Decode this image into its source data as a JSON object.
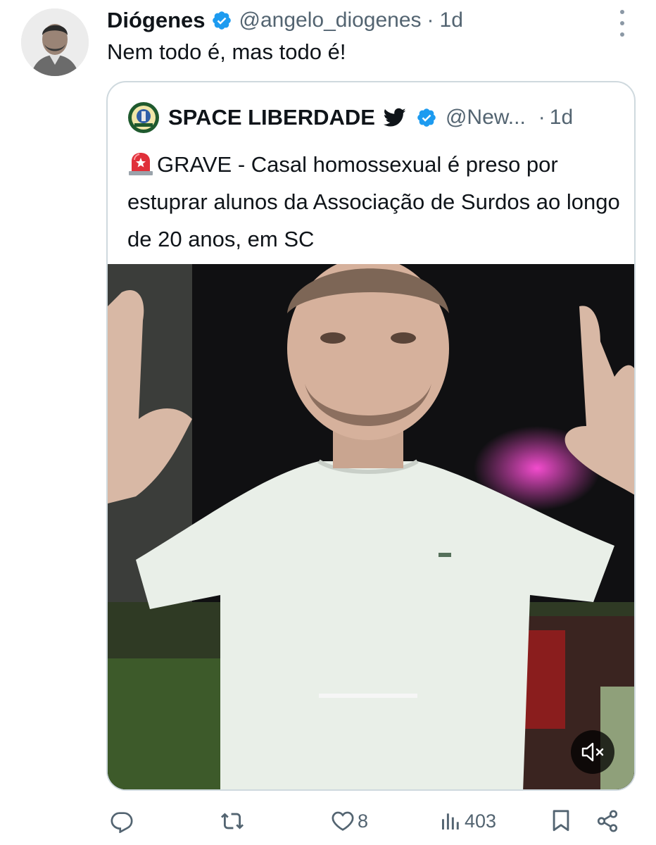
{
  "tweet": {
    "author_name": "Diógenes",
    "handle": "@angelo_diogenes",
    "separator": "·",
    "time": "1d",
    "text": "Nem todo é, mas todo é!"
  },
  "quoted_tweet": {
    "author_name": "SPACE LIBERDADE",
    "handle": "@New...",
    "separator": "·",
    "time": "1d",
    "text": "GRAVE - Casal homossexual é preso por estuprar alunos da Associação de Surdos ao longo de 20 anos, em SC"
  },
  "actions": {
    "reply_count": "",
    "retweet_count": "",
    "like_count": "8",
    "views_count": "403"
  },
  "icons": [
    "verified-badge-icon",
    "twitter-bird-icon",
    "siren-emoji-icon",
    "mute-icon",
    "reply-icon",
    "retweet-icon",
    "like-icon",
    "views-icon",
    "bookmark-icon",
    "share-icon",
    "more-icon"
  ],
  "colors": {
    "verified": "#1d9bf0",
    "secondary_text": "#536471",
    "border": "#cfd9de",
    "text": "#0f1419"
  }
}
